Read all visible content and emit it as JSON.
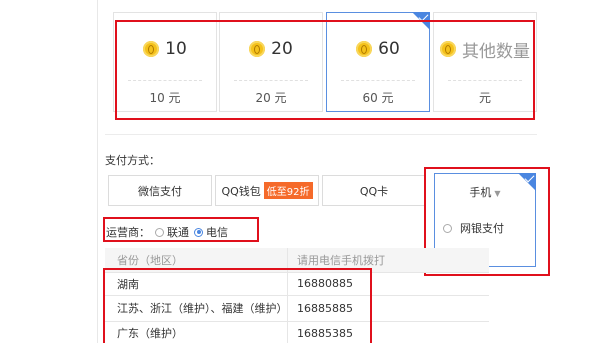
{
  "amounts": [
    {
      "value": "10",
      "price": "10 元",
      "selected": false
    },
    {
      "value": "20",
      "price": "20 元",
      "selected": false
    },
    {
      "value": "60",
      "price": "60 元",
      "selected": true
    },
    {
      "value": "其他数量",
      "price": "元",
      "selected": false
    }
  ],
  "payment": {
    "label": "支付方式：",
    "wechat": "微信支付",
    "qq_wallet": "QQ钱包",
    "qq_wallet_badge": "低至92折",
    "qq_card": "QQ卡",
    "dropdown": {
      "selected": "手机",
      "arrow": "▼",
      "options": [
        "网银支付",
        "手机"
      ],
      "checked_option": "手机"
    }
  },
  "operator": {
    "label": "运营商：",
    "options": [
      "联通",
      "电信"
    ],
    "selected": "电信"
  },
  "table": {
    "headers": [
      "省份（地区）",
      "请用电信手机拨打"
    ],
    "rows": [
      [
        "湖南",
        "16880885"
      ],
      [
        "江苏、浙江（维护）、福建（维护）",
        "16885885"
      ],
      [
        "广东（维护）",
        "16885385"
      ]
    ]
  },
  "colors": {
    "accent": "#4a86e0",
    "highlight_red": "#e0101c",
    "badge": "#f56a2a",
    "coin": "#f4c11a"
  }
}
